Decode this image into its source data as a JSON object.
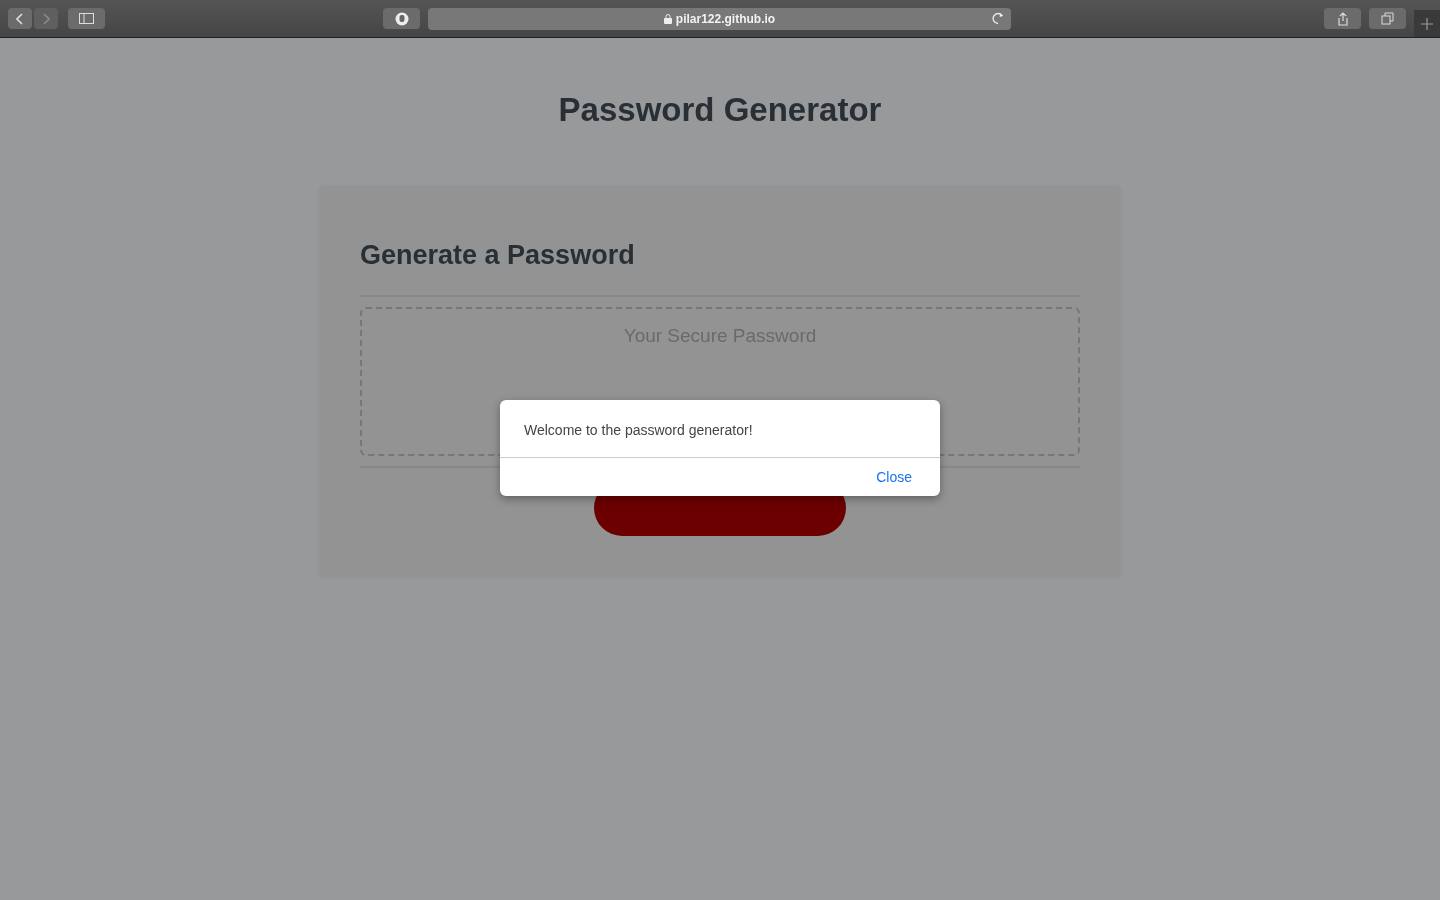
{
  "browser": {
    "back": {
      "disabled": false
    },
    "forward": {
      "disabled": true
    },
    "address": "pilar122.github.io"
  },
  "page": {
    "title": "Password Generator",
    "card_title": "Generate a Password",
    "placeholder": "Your Secure Password"
  },
  "dialog": {
    "message": "Welcome to the password generator!",
    "button": "Close"
  }
}
